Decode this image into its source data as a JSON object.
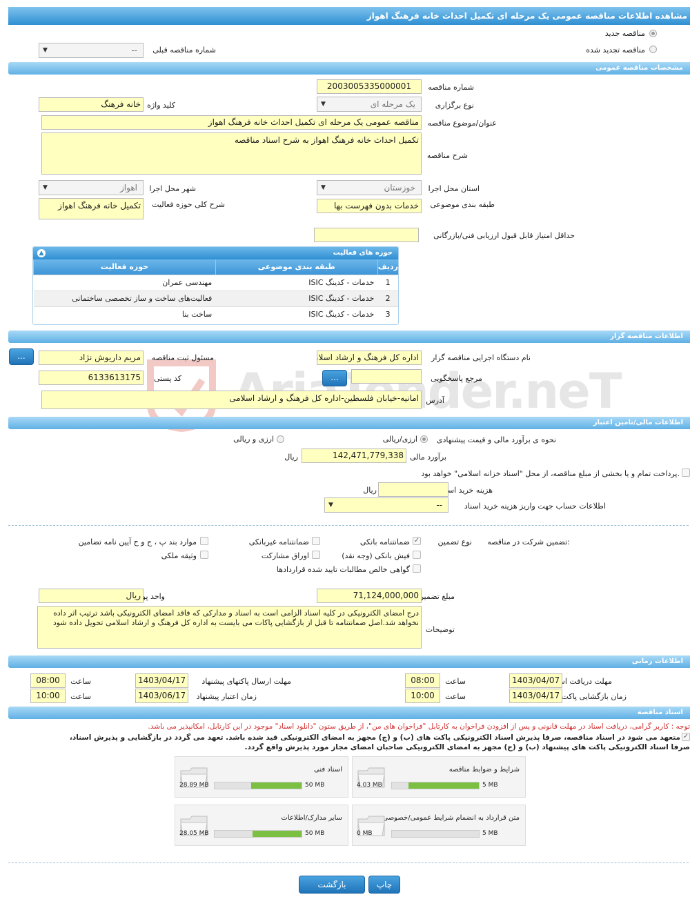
{
  "header": {
    "title": "مشاهده اطلاعات مناقصه عمومی یک مرحله ای تکمیل احداث خانه فرهنگ اهواز"
  },
  "top": {
    "new_label": "مناقصه جدید",
    "renewed_label": "مناقصه تجدید شده",
    "prev_no_label": "شماره مناقصه قبلی",
    "prev_no_value": "--"
  },
  "general": {
    "section": "مشخصات مناقصه عمومی",
    "no_label": "شماره مناقصه",
    "no_value": "2003005335000001",
    "type_label": "نوع برگزاری",
    "type_value": "یک مرحله ای",
    "keyword_label": "کلید واژه",
    "keyword_value": "خانه فرهنگ",
    "title_label": "عنوان/موضوع مناقصه",
    "title_value": "مناقصه عمومی یک مرحله ای تکمیل احداث خانه فرهنگ اهواز",
    "desc_label": "شرح مناقصه",
    "desc_value": "تکمیل احداث خانه فرهنگ اهواز به شرح اسناد مناقصه",
    "province_label": "استان محل اجرا",
    "province_value": "خوزستان",
    "city_label": "شهر محل اجرا",
    "city_value": "اهواز",
    "category_label": "طبقه بندی موضوعی",
    "category_value": "خدمات بدون فهرست بها",
    "scope_label": "شرح کلی حوزه فعالیت",
    "scope_value": "تکمیل خانه فرهنگ اهواز",
    "minscore_label": "حداقل امتیاز قابل قبول ارزیابی فنی/بازرگانی",
    "minscore_value": ""
  },
  "activities": {
    "title": "حوزه های فعالیت",
    "col_row": "ردیف",
    "col_cat": "طبقه بندی موضوعی",
    "col_field": "حوزه فعالیت",
    "rows": [
      {
        "n": "1",
        "cat": "خدمات - کدینگ ISIC",
        "field": "مهندسی عمران"
      },
      {
        "n": "2",
        "cat": "خدمات - کدینگ ISIC",
        "field": "فعالیت‌های ساخت و ساز تخصصی ساختمانی"
      },
      {
        "n": "3",
        "cat": "خدمات - کدینگ ISIC",
        "field": "ساخت بنا"
      }
    ]
  },
  "org": {
    "section": "اطلاعات مناقصه گزار",
    "name_label": "نام دستگاه اجرایی مناقصه گزار",
    "name_value": "اداره کل فرهنگ و ارشاد اسلامی",
    "officer_label": "مسئول ثبت مناقصه",
    "officer_value": "مریم داریوش نژاد",
    "ref_label": "مرجع پاسخگویی",
    "ref_value": "",
    "postal_label": "کد پستی",
    "postal_value": "6133613175",
    "address_label": "آدرس",
    "address_value": "امانیه-خیابان فلسطین-اداره کل فرهنگ و ارشاد اسلامی",
    "dots": "..."
  },
  "finance": {
    "section": "اطلاعات مالی/تامین اعتبار",
    "method_label": "نحوه ی برآورد مالی و قیمت پیشنهادی",
    "opt1": "ارزی/ریالی",
    "opt2": "ارزی و ریالی",
    "estimate_label": "برآورد مالی",
    "estimate_value": "142,471,779,338",
    "rial": "ریال",
    "payment_text": "پرداخت تمام و یا بخشی از مبلغ مناقصه، از محل \"اسناد خزانه اسلامی\" خواهد بود.",
    "doccost_label": "هزینه خرید اسناد",
    "doccost_value": "",
    "doccost_unit": "ریال",
    "account_label": "اطلاعات حساب جهت واریز هزینه خرید اسناد",
    "account_value": "--"
  },
  "guarantee": {
    "participation_label": "تضمین شرکت در مناقصه:",
    "type_label": "نوع تضمین",
    "bank_guarantee": "ضمانتنامه بانکی",
    "nonbank_guarantee": "ضمانتنامه غیربانکی",
    "regulation_items": "موارد بند پ ، ج و ح آیین نامه تضامین",
    "bank_receipt": "فیش بانکی (وجه نقد)",
    "participation_bonds": "اوراق مشارکت",
    "property": "وثیقه ملکی",
    "claims": "گواهی خالص مطالبات تایید شده قراردادها",
    "amount_label": "مبلغ تضمین",
    "amount_value": "71,124,000,000",
    "currency_label": "واحد پول",
    "currency_value": "ریال",
    "notes_label": "توضیحات",
    "notes_value": "درج امضای الکترونیکی در کلیه اسناد الزامی است به اسناد و مدارکی که فاقد امضای الکترونیکی باشد ترتیب اثر داده نخواهد شد.اصل ضمانتنامه تا قبل از بازگشایی پاکات می بایست به اداره کل فرهنگ و ارشاد اسلامی تحویل داده شود"
  },
  "timing": {
    "section": "اطلاعات زمانی",
    "receive_label": "مهلت دریافت اسناد",
    "receive_date": "1403/04/07",
    "receive_time": "08:00",
    "send_label": "مهلت ارسال پاکتهای پیشنهاد",
    "send_date": "1403/04/17",
    "send_time": "08:00",
    "open_label": "زمان بازگشایی پاکت ها",
    "open_date": "1403/04/17",
    "open_time": "10:00",
    "validity_label": "زمان اعتبار پیشنهاد",
    "validity_date": "1403/06/17",
    "validity_time": "10:00",
    "time_label": "ساعت"
  },
  "docs": {
    "section": "اسناد مناقصه",
    "note": "توجه : کاربر گرامی، دریافت اسناد در مهلت قانونی و پس از افزودن فراخوان به کارتابل \"فراخوان های من\"، از طریق ستون \"دانلود اسناد\" موجود در این کارتابل، امکانپذیر می باشد.",
    "commit1": "متعهد می شود در اسناد مناقصه، صرفاً پذیرش اسناد الکترونیکی پاکت های (ب) و (ج) مجهز به امضای الکترونیکی قید شده باشد. تعهد می گردد در بازگشایی و پذیرش اسناد،",
    "commit2": "صرفاً اسناد الکترونیکی پاکت های پیشنهاد (ب) و (ج) مجهز به امضای الکترونیکی صاحبان امضای مجاز مورد پذیرش واقع گردد.",
    "files": [
      {
        "name": "شرایط و ضوابط مناقصه",
        "used": "4.03 MB",
        "max": "5 MB",
        "pct": 80.6
      },
      {
        "name": "اسناد فنی",
        "used": "28.89 MB",
        "max": "50 MB",
        "pct": 57.8
      },
      {
        "name": "متن قرارداد به انضمام شرایط عمومی/خصوصی",
        "used": "0 MB",
        "max": "5 MB",
        "pct": 0
      },
      {
        "name": "سایر مدارک/اطلاعات",
        "used": "28.05 MB",
        "max": "50 MB",
        "pct": 56.1
      }
    ]
  },
  "footer": {
    "print": "چاپ",
    "back": "بازگشت"
  },
  "watermark": "AriaTender.neT"
}
